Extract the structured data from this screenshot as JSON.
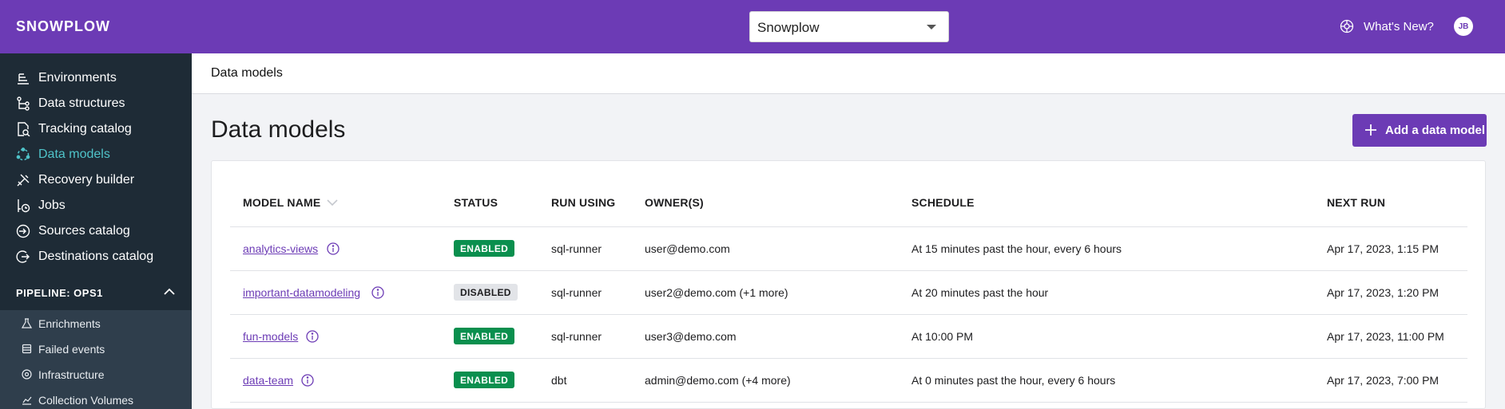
{
  "header": {
    "logo": "SNOWPLOW",
    "org_select_value": "Snowplow",
    "whats_new": "What's New?",
    "avatar_initials": "JB"
  },
  "sidebar": {
    "items": [
      {
        "label": "Environments",
        "icon": "environments-icon"
      },
      {
        "label": "Data structures",
        "icon": "data-structures-icon"
      },
      {
        "label": "Tracking catalog",
        "icon": "tracking-catalog-icon"
      },
      {
        "label": "Data models",
        "icon": "data-models-icon",
        "active": true
      },
      {
        "label": "Recovery builder",
        "icon": "recovery-builder-icon"
      },
      {
        "label": "Jobs",
        "icon": "jobs-icon"
      },
      {
        "label": "Sources catalog",
        "icon": "sources-catalog-icon"
      },
      {
        "label": "Destinations catalog",
        "icon": "destinations-catalog-icon"
      }
    ],
    "pipeline_label": "PIPELINE: OPS1",
    "sub_items": [
      {
        "label": "Enrichments",
        "icon": "enrichments-icon"
      },
      {
        "label": "Failed events",
        "icon": "failed-events-icon"
      },
      {
        "label": "Infrastructure",
        "icon": "infrastructure-icon"
      },
      {
        "label": "Collection Volumes",
        "icon": "collection-volumes-icon"
      }
    ]
  },
  "page": {
    "breadcrumb": "Data models",
    "title": "Data models",
    "add_button": "Add a data model"
  },
  "table": {
    "columns": [
      "MODEL NAME",
      "STATUS",
      "RUN USING",
      "OWNER(S)",
      "SCHEDULE",
      "NEXT RUN"
    ],
    "rows": [
      {
        "name": "analytics-views",
        "status": "ENABLED",
        "run_using": "sql-runner",
        "owners": "user@demo.com",
        "schedule": "At 15 minutes past the hour, every 6 hours",
        "next_run": "Apr 17, 2023, 1:15 PM"
      },
      {
        "name": "important-datamodeling",
        "status": "DISABLED",
        "run_using": "sql-runner",
        "owners": "user2@demo.com (+1 more)",
        "schedule": "At 20 minutes past the hour",
        "next_run": "Apr 17, 2023, 1:20 PM"
      },
      {
        "name": "fun-models",
        "status": "ENABLED",
        "run_using": "sql-runner",
        "owners": "user3@demo.com",
        "schedule": "At 10:00 PM",
        "next_run": "Apr 17, 2023, 11:00 PM"
      },
      {
        "name": "data-team",
        "status": "ENABLED",
        "run_using": "dbt",
        "owners": "admin@demo.com (+4 more)",
        "schedule": "At 0 minutes past the hour, every 6 hours",
        "next_run": "Apr 17, 2023, 7:00 PM"
      }
    ]
  },
  "colors": {
    "brand": "#6c3bb5",
    "sidebar": "#1e2b36",
    "active_nav": "#4fc3c9",
    "enabled": "#0a8f4e"
  }
}
